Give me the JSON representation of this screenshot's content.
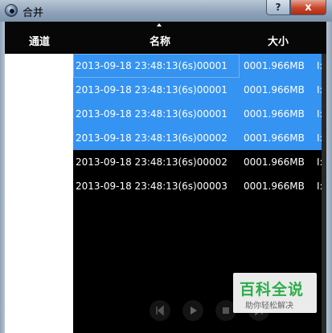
{
  "window": {
    "title": "合并",
    "help_label": "?",
    "close_label": "x"
  },
  "table": {
    "columns": [
      "通道",
      "名称",
      "大小"
    ],
    "rows": [
      {
        "name": "2013-09-18 23:48:13(6s)00001",
        "size": "0001.966MB",
        "extra": "I:",
        "selected": true,
        "focused": true
      },
      {
        "name": "2013-09-18 23:48:13(6s)00001",
        "size": "0001.966MB",
        "extra": "I:",
        "selected": true
      },
      {
        "name": "2013-09-18 23:48:13(6s)00001",
        "size": "0001.966MB",
        "extra": "I:",
        "selected": true
      },
      {
        "name": "2013-09-18 23:48:13(6s)00002",
        "size": "0001.966MB",
        "extra": "I:",
        "selected": true
      },
      {
        "name": "2013-09-18 23:48:13(6s)00002",
        "size": "0001.966MB",
        "extra": "I:",
        "selected": false
      },
      {
        "name": "2013-09-18 23:48:13(6s)00003",
        "size": "0001.966MB",
        "extra": "I:",
        "selected": false
      }
    ]
  },
  "watermark": {
    "main": "百科全说",
    "sub": "助你轻松解决"
  },
  "controls": [
    "prev-icon",
    "play-icon",
    "stop-icon",
    "next-icon"
  ],
  "colors": {
    "selection": "#3593f2",
    "background": "#000000",
    "watermark_green": "#2aae4a"
  }
}
